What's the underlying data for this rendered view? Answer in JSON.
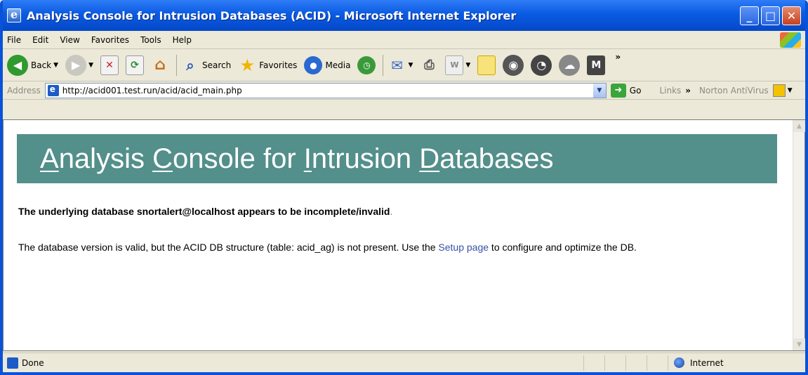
{
  "window": {
    "title": "Analysis Console for Intrusion Databases (ACID) - Microsoft Internet Explorer",
    "controls": {
      "minimize": "_",
      "maximize": "□",
      "close": "✕"
    }
  },
  "menubar": {
    "items": [
      "File",
      "Edit",
      "View",
      "Favorites",
      "Tools",
      "Help"
    ]
  },
  "toolbar": {
    "back_label": "Back",
    "search_label": "Search",
    "favorites_label": "Favorites",
    "media_label": "Media",
    "overflow": "»",
    "icons": [
      "back-icon",
      "forward-icon",
      "stop-icon",
      "refresh-icon",
      "home-icon",
      "search-icon",
      "favorites-icon",
      "media-icon",
      "history-icon",
      "mail-icon",
      "print-icon",
      "edit-icon",
      "discuss-icon",
      "messenger-icon",
      "research-icon",
      "mx-icon"
    ]
  },
  "addressbar": {
    "label": "Address",
    "url": "http://acid001.test.run/acid/acid_main.php",
    "go_label": "Go",
    "links_label": "Links",
    "links_chevron": "»",
    "norton_label": "Norton AntiVirus"
  },
  "page": {
    "banner_title_parts": [
      "A",
      "nalysis ",
      "C",
      "onsole for ",
      "I",
      "ntrusion ",
      "D",
      "atabases"
    ],
    "banner_color": "#538f8b",
    "warning": "The underlying database snortalert@localhost appears to be incomplete/invalid",
    "warning_end": ".",
    "message_before": "The database version is valid, but the ACID DB structure (table: acid_ag) is not present. Use the ",
    "message_link": "Setup page",
    "message_after": " to configure and optimize the DB."
  },
  "statusbar": {
    "status": "Done",
    "zone": "Internet"
  }
}
